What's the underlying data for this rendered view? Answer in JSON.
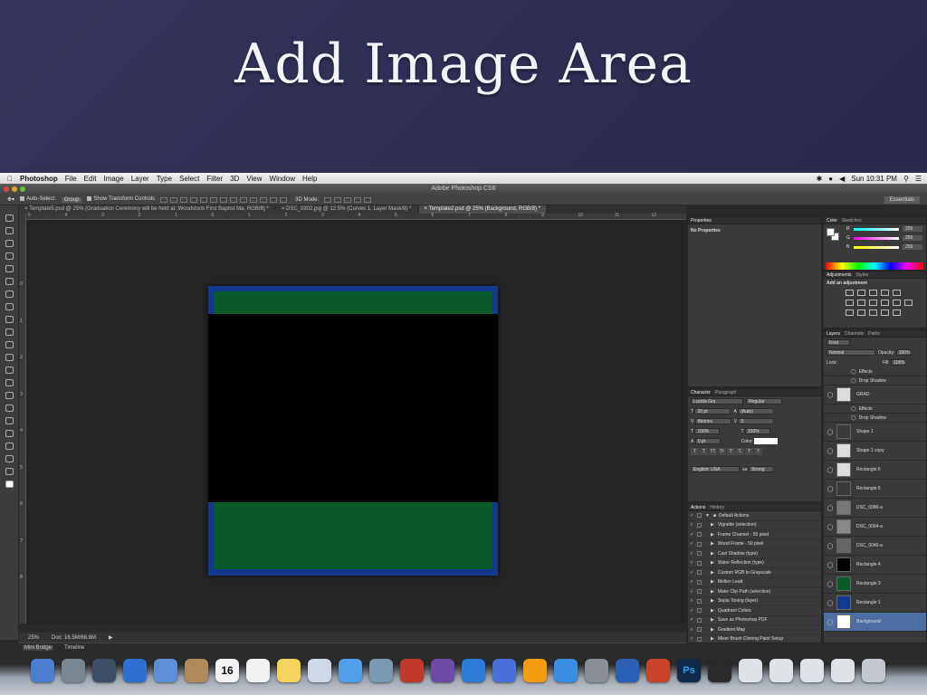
{
  "slide": {
    "title": "Add Image Area"
  },
  "menubar": {
    "app": "Photoshop",
    "items": [
      "File",
      "Edit",
      "Image",
      "Layer",
      "Type",
      "Select",
      "Filter",
      "3D",
      "View",
      "Window",
      "Help"
    ],
    "clock": "Sun 10:31 PM"
  },
  "window": {
    "title": "Adobe Photoshop CS6"
  },
  "options": {
    "auto_select_label": "Auto-Select:",
    "auto_select_value": "Group",
    "transform_label": "Show Transform Controls",
    "mode_label": "3D Mode:",
    "workspace": "Essentials"
  },
  "tabs": [
    {
      "label": "Template5.psd @ 25% (Graduation Ceremony will be held at: Woodstock First Baptist Ma, RGB/8) *"
    },
    {
      "label": "DSC_0302.jpg @ 12.5% (Curves 1, Layer Mask/8) *"
    },
    {
      "label": "Template2.psd @ 25% (Background, RGB/8) *"
    }
  ],
  "ruler": {
    "h": [
      "5",
      "4",
      "3",
      "2",
      "1",
      "0",
      "1",
      "2",
      "3",
      "4",
      "5",
      "6",
      "7",
      "8",
      "9",
      "10",
      "11",
      "12"
    ],
    "v": [
      "0",
      "1",
      "2",
      "3",
      "4",
      "5",
      "6",
      "7",
      "8"
    ]
  },
  "status": {
    "zoom": "25%",
    "doc": "Doc: 16.5M/68.8M"
  },
  "bottom_tabs": [
    "Mini Bridge",
    "Timeline"
  ],
  "properties": {
    "tab": "Properties",
    "empty": "No Properties"
  },
  "character": {
    "tabs": [
      "Character",
      "Paragraph"
    ],
    "font": "Lucida Gra",
    "style": "Regular",
    "size": "20 pt",
    "leading": "(Auto)",
    "kerning": "Metrics",
    "tracking": "5",
    "vscale": "100%",
    "hscale": "100%",
    "baseline": "0 pt",
    "color_label": "Color:",
    "language": "English: USA",
    "antialias_prefix": "aa",
    "antialias": "Strong",
    "glyphs": [
      "T",
      "T",
      "TT",
      "Tr",
      "T'",
      "T,",
      "T",
      "T"
    ]
  },
  "actions": {
    "tabs": [
      "Actions",
      "History"
    ],
    "set_name": "Default Actions",
    "items": [
      "Vignette (selection)",
      "Frame Channel - 50 pixel",
      "Wood Frame - 50 pixel",
      "Cast Shadow (type)",
      "Water Reflection (type)",
      "Custom RGB to Grayscale",
      "Molten Lead",
      "Make Clip Path (selection)",
      "Sepia Toning (layer)",
      "Quadrant Colors",
      "Save as Photoshop PDF",
      "Gradient Map",
      "Mixer Brush Cloning Paint Setup"
    ]
  },
  "color": {
    "tabs": [
      "Color",
      "Swatches"
    ],
    "r_label": "R",
    "g_label": "G",
    "b_label": "B",
    "r": "255",
    "g": "255",
    "b": "255"
  },
  "adjustments": {
    "tabs": [
      "Adjustments",
      "Styles"
    ],
    "title": "Add an adjustment"
  },
  "layers": {
    "tabs": [
      "Layers",
      "Channels",
      "Paths"
    ],
    "filter": "Kind",
    "blend": "Normal",
    "opacity_label": "Opacity:",
    "opacity": "100%",
    "lock_label": "Lock:",
    "fill_label": "Fill:",
    "fill": "100%",
    "rows": [
      {
        "name": "Effects",
        "sub": true
      },
      {
        "name": "Drop Shadow",
        "sub": true
      },
      {
        "name": "GRAD",
        "thumb": "#dddddd"
      },
      {
        "name": "Effects",
        "sub": true
      },
      {
        "name": "Drop Shadow",
        "sub": true
      },
      {
        "name": "Shape 1",
        "thumb": "#3a3a3a"
      },
      {
        "name": "Shape 1 copy",
        "thumb": "#dddddd"
      },
      {
        "name": "Rectangle 6",
        "thumb": "#dddddd"
      },
      {
        "name": "Rectangle 5",
        "thumb": "#3a3a3a"
      },
      {
        "name": "DSC_0080-a",
        "thumb": "#777777"
      },
      {
        "name": "DSC_0064-a",
        "thumb": "#888888"
      },
      {
        "name": "DSC_0046-a",
        "thumb": "#666666"
      },
      {
        "name": "Rectangle 4",
        "thumb": "#000000"
      },
      {
        "name": "Rectangle 3",
        "thumb": "#0b5a2b"
      },
      {
        "name": "Rectangle 1",
        "thumb": "#13388d"
      },
      {
        "name": "Background",
        "thumb": "#ffffff",
        "selected": true
      }
    ]
  },
  "doc_colors": {
    "frame": "#13388d",
    "green": "#0b5a2b",
    "black": "#000000"
  },
  "dock": {
    "icons": [
      "finder-icon",
      "launchpad-icon",
      "mission-control-icon",
      "safari-icon",
      "mail-icon",
      "contacts-icon",
      "calendar-icon",
      "reminders-icon",
      "notes-icon",
      "preview-icon",
      "messages-icon",
      "facetime-icon",
      "photo-booth-icon",
      "imovie-icon",
      "iphoto-icon",
      "itunes-icon",
      "ibooks-icon",
      "app-store-icon",
      "system-preferences-icon",
      "word-icon",
      "powerpoint-icon",
      "photoshop-icon",
      "itunes-icon",
      "stack-icon",
      "stack-icon",
      "stack-icon",
      "stack-icon",
      "trash-icon"
    ],
    "calendar_day": "16",
    "ps_label": "Ps"
  }
}
